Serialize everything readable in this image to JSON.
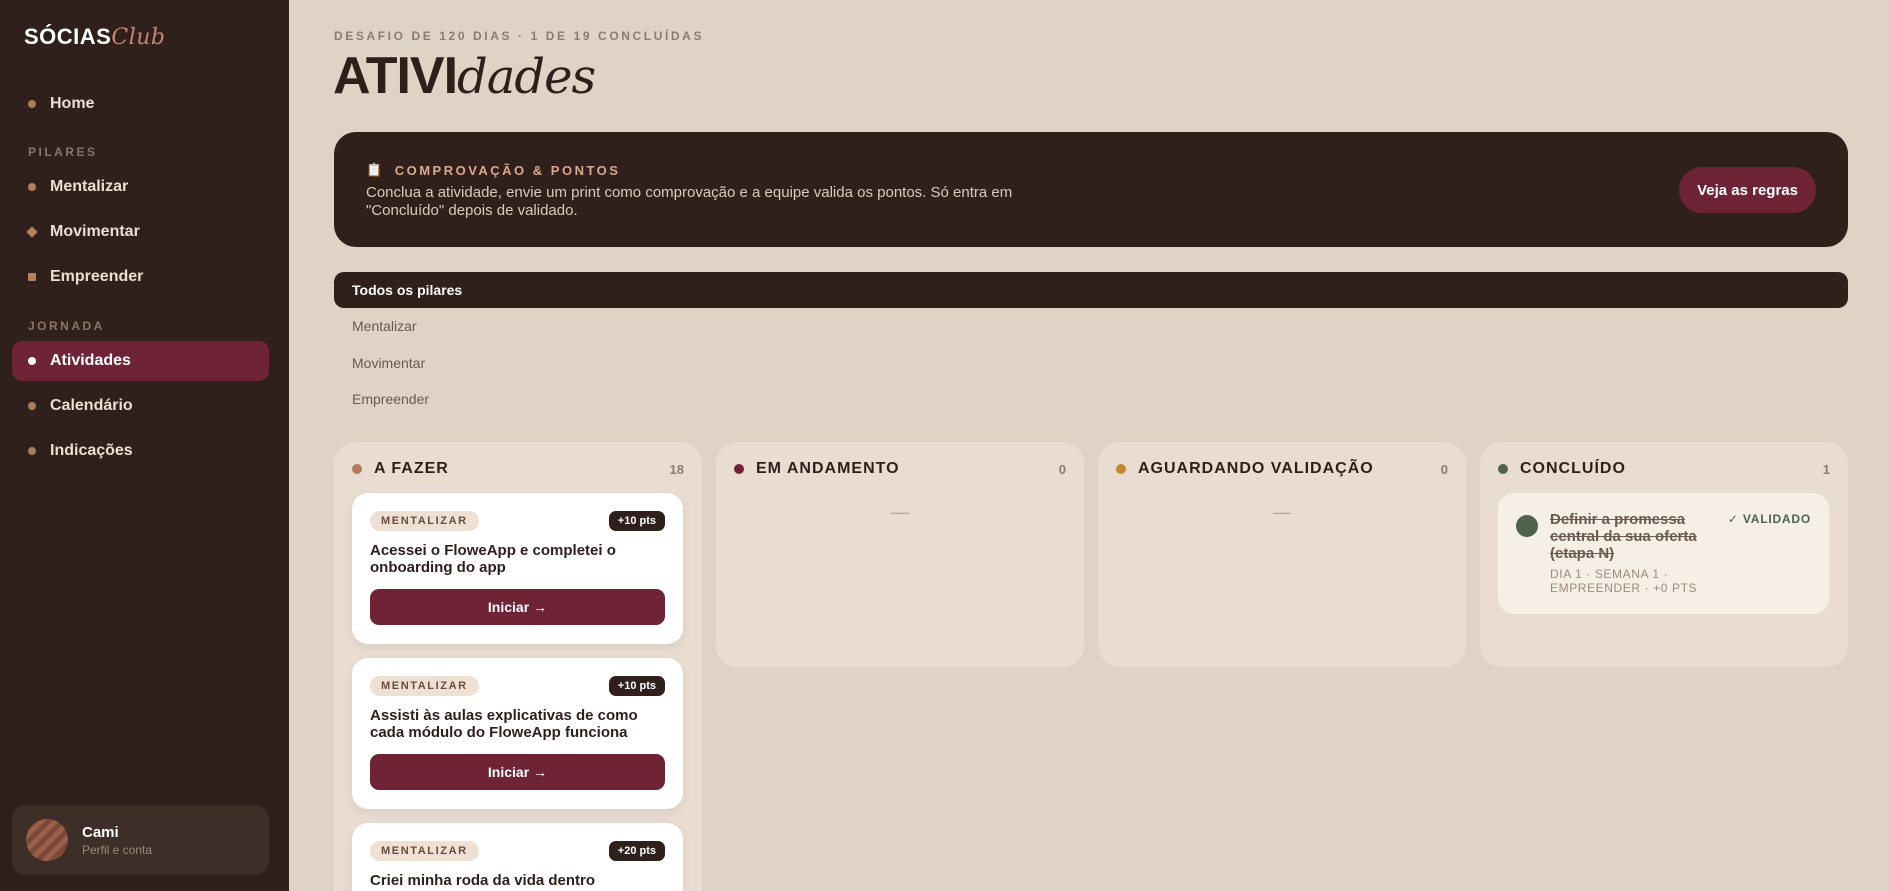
{
  "brand": {
    "strong": "SÓCIAS",
    "script": "Club"
  },
  "nav": {
    "home": "Home",
    "pilares_label": "PILARES",
    "pilares": [
      "Mentalizar",
      "Movimentar",
      "Empreender"
    ],
    "jornada_label": "JORNADA",
    "jornada": [
      "Atividades",
      "Calendário",
      "Indicações"
    ]
  },
  "profile": {
    "name": "Cami",
    "subtitle": "Perfil e conta"
  },
  "header": {
    "kicker": "DESAFIO DE 120 DIAS · 1 DE 19 CONCLUÍDAS",
    "title_strong": "ATIVI",
    "title_script": "dades"
  },
  "banner": {
    "heading": "COMPROVAÇÃO & PONTOS",
    "text": "Conclua a atividade, envie um print como comprovação e a equipe valida os pontos. Só entra em \"Concluído\" depois de validado.",
    "button": "Veja as regras"
  },
  "filters": [
    "Todos os pilares",
    "Mentalizar",
    "Movimentar",
    "Empreender"
  ],
  "columns": [
    {
      "title": "A FAZER",
      "count": "18",
      "color": "#b07a5c"
    },
    {
      "title": "EM ANDAMENTO",
      "count": "0",
      "color": "#6e2336",
      "empty": "—"
    },
    {
      "title": "AGUARDANDO VALIDAÇÃO",
      "count": "0",
      "color": "#c08a2e",
      "empty": "—"
    },
    {
      "title": "CONCLUÍDO",
      "count": "1",
      "color": "#4e624d"
    }
  ],
  "todo_cards": [
    {
      "tag": "MENTALIZAR",
      "points": "+10 pts",
      "text": "Acessei o FloweApp e completei o onboarding do app",
      "button": "Iniciar →"
    },
    {
      "tag": "MENTALIZAR",
      "points": "+10 pts",
      "text": "Assisti às aulas explicativas de como cada módulo do FloweApp funciona",
      "button": "Iniciar →"
    },
    {
      "tag": "MENTALIZAR",
      "points": "+20 pts",
      "text": "Criei minha roda da vida dentro"
    }
  ],
  "done_card": {
    "title": "Definir a promessa central da sua oferta (etapa N)",
    "status": "✓ VALIDADO",
    "meta": "DIA 1 · SEMANA 1 · EMPREENDER · +0 PTS"
  }
}
